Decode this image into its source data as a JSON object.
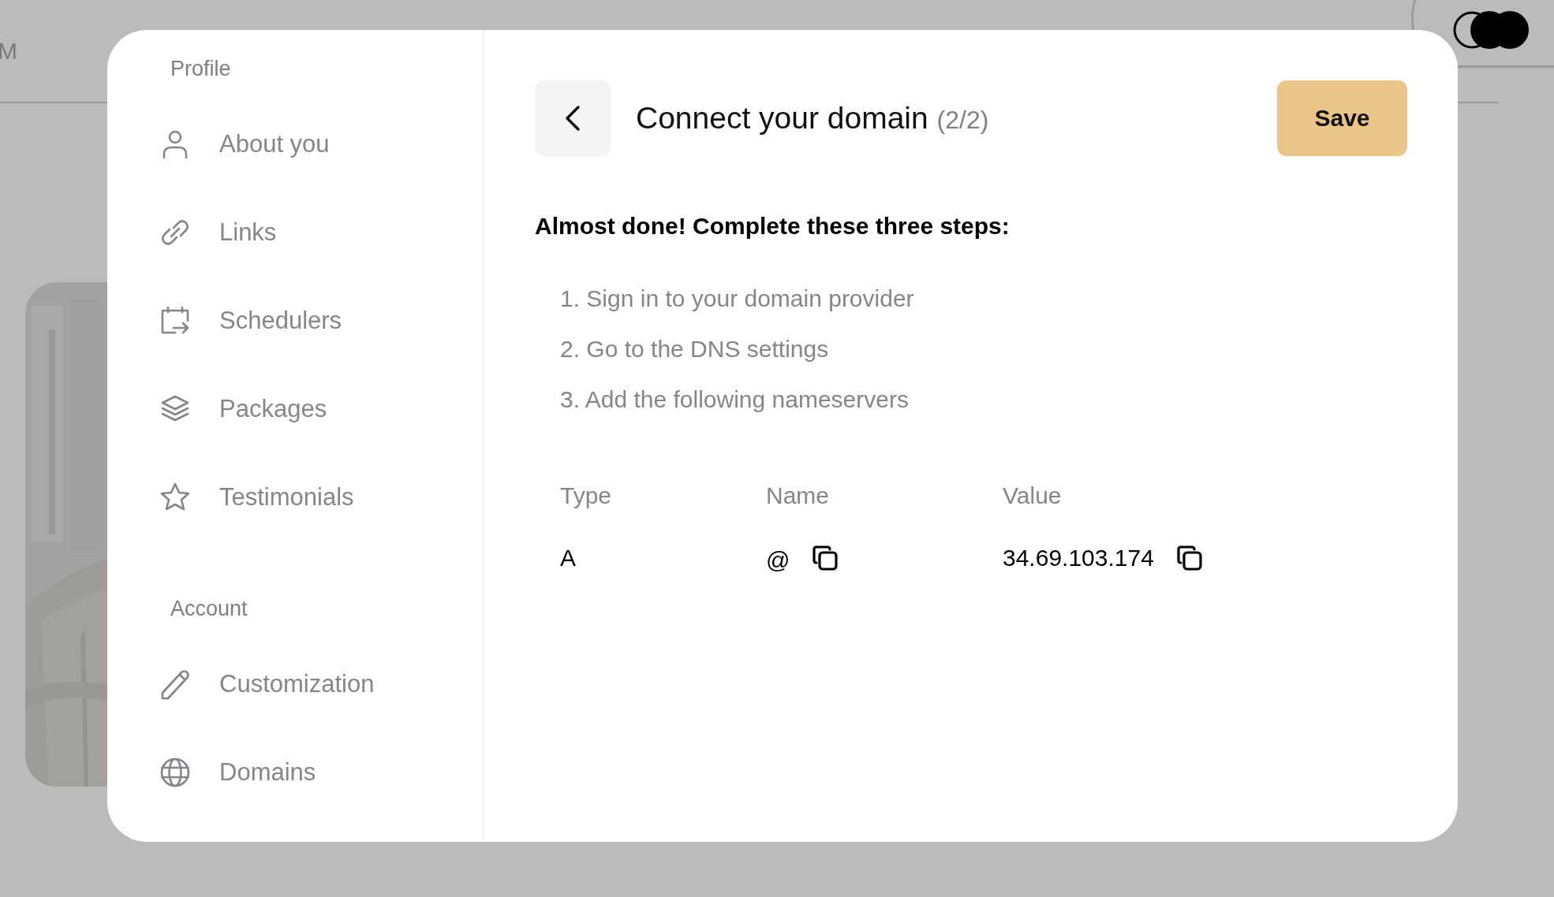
{
  "background": {
    "header_text": "M"
  },
  "sidebar": {
    "sections": [
      {
        "heading": "Profile",
        "items": [
          {
            "label": "About you"
          },
          {
            "label": "Links"
          },
          {
            "label": "Schedulers"
          },
          {
            "label": "Packages"
          },
          {
            "label": "Testimonials"
          }
        ]
      },
      {
        "heading": "Account",
        "items": [
          {
            "label": "Customization"
          },
          {
            "label": "Domains"
          }
        ]
      }
    ]
  },
  "header": {
    "title": "Connect your domain",
    "step": "(2/2)",
    "save_label": "Save"
  },
  "intro": "Almost done! Complete these three steps:",
  "steps": [
    "1. Sign in to your domain provider",
    "2. Go to the DNS settings",
    "3. Add the following nameservers"
  ],
  "table": {
    "columns": [
      "Type",
      "Name",
      "Value"
    ],
    "rows": [
      {
        "type": "A",
        "name": "@",
        "value": "34.69.103.174"
      }
    ]
  }
}
